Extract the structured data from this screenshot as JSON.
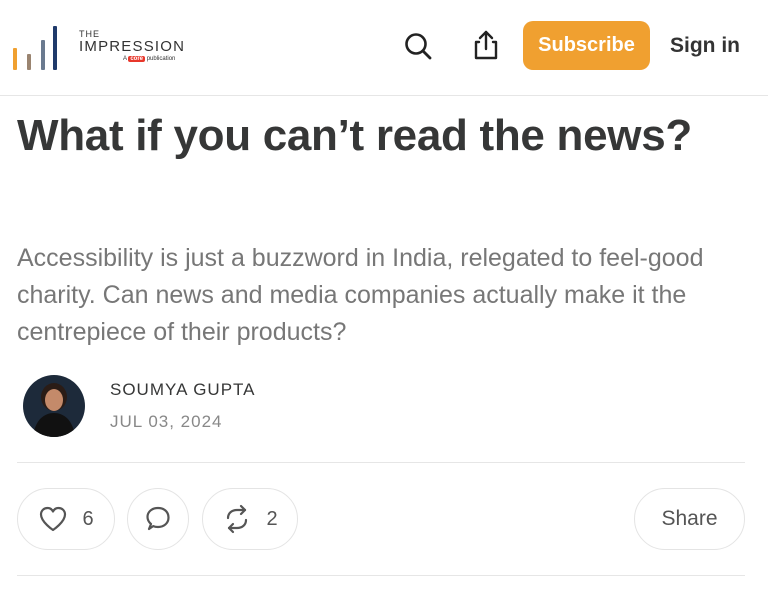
{
  "header": {
    "logo": {
      "the": "THE",
      "name": "IMPRESSION",
      "tag_prefix": "A",
      "tag_core": "core",
      "tag_suffix": "publication",
      "bar_colors": [
        "#f0a030",
        "#9a8470",
        "#6a7a8f",
        "#1f3a6b"
      ]
    },
    "subscribe_label": "Subscribe",
    "signin_label": "Sign in",
    "accent_color": "#f0a030"
  },
  "article": {
    "title": "What if you can’t read the news?",
    "subtitle": "Accessibility is just a buzzword in India, relegated to feel-good charity. Can news and media companies actually make it the centrepiece of their products?",
    "author": "SOUMYA GUPTA",
    "date": "JUL 03, 2024"
  },
  "actions": {
    "like_count": "6",
    "restack_count": "2",
    "share_label": "Share"
  }
}
